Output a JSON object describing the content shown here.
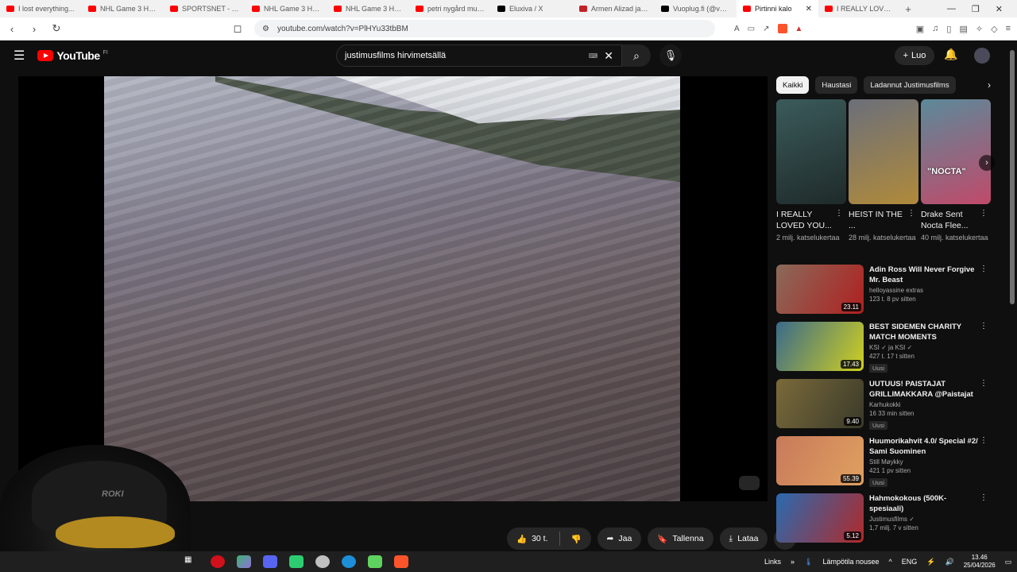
{
  "browser": {
    "tabs": [
      {
        "title": "I lost everything...",
        "color": "#ff0000"
      },
      {
        "title": "NHL Game 3 Highli",
        "color": "#ff0000"
      },
      {
        "title": "SPORTSNET - YouTu",
        "color": "#ff0000"
      },
      {
        "title": "NHL Game 3 Highli",
        "color": "#ff0000"
      },
      {
        "title": "NHL Game 3 Highli",
        "color": "#ff0000"
      },
      {
        "title": "petri nygård mun k",
        "color": "#ff0000"
      },
      {
        "title": "Eluxiva / X",
        "color": "#000000"
      },
      {
        "title": "Armen Alizad ja Se",
        "color": "#c42027"
      },
      {
        "title": "Vuoplug.fi (@vuopl",
        "color": "#000000"
      },
      {
        "title": "Pirtinni kalo",
        "color": "#ff0000",
        "active": true
      },
      {
        "title": "I REALLY LOVED YO",
        "color": "#ff0000"
      }
    ],
    "url": "youtube.com/watch?v=PlHYu33tbBM"
  },
  "header": {
    "logo_text": "YouTube",
    "region": "FI",
    "search_query": "justimusfilms hirvimetsällä",
    "create_label": "Luo"
  },
  "actions": {
    "likes": "30 t.",
    "share_label": "Jaa",
    "save_label": "Tallenna",
    "download_label": "Lataa"
  },
  "chips": [
    "Kaikki",
    "Haustasi",
    "Ladannut Justimusfilms"
  ],
  "shorts": [
    {
      "title": "I REALLY LOVED YOU...",
      "views": "2 milj. katselukertaa",
      "color1": "#3a5b5a",
      "color2": "#1f2a2a"
    },
    {
      "title": "HEIST IN THE ...",
      "views": "28 milj. katselukertaa",
      "color1": "#6b6f7a",
      "color2": "#b08a3a"
    },
    {
      "title": "Drake Sent Nocta Flee...",
      "views": "40 milj. katselukertaa",
      "color1": "#5b8a9a",
      "color2": "#c04a6a",
      "overlay": "\"NOCTA\""
    }
  ],
  "recs": [
    {
      "title": "Adin Ross Will Never Forgive Mr. Beast",
      "channel": "helloyassine extras",
      "meta": "123 t.  8 pv sitten",
      "duration": "23.11",
      "color1": "#8a6a5a",
      "color2": "#b02020",
      "badge": ""
    },
    {
      "title": "BEST SIDEMEN CHARITY MATCH MOMENTS",
      "channel": "KSI ✓ ja KSI ✓",
      "meta": "427 t.  17 t sitten",
      "duration": "17.43",
      "color1": "#3a6a8a",
      "color2": "#d0d020",
      "badge": "Uusi"
    },
    {
      "title": "UUTUUS! PAISTAJAT GRILLIMAKKARA @Paistajat",
      "channel": "Karhukokki",
      "meta": "16  33 min sitten",
      "duration": "9.40",
      "color1": "#7a6a3a",
      "color2": "#3a3a2a",
      "badge": "Uusi"
    },
    {
      "title": "Huumorikahvit 4.0/ Special #2/ Sami Suominen",
      "channel": "Still Møykky",
      "meta": "421  1 pv sitten",
      "duration": "55.39",
      "color1": "#c87a5a",
      "color2": "#e0a060",
      "badge": "Uusi"
    },
    {
      "title": "Hahmokokous (500K-spesiaali)",
      "channel": "Justimusfilms ✓",
      "meta": "1,7 milj.  7 v sitten",
      "duration": "5.12",
      "color1": "#2a6ab0",
      "color2": "#b02a2a",
      "badge": ""
    }
  ],
  "webcam": {
    "cap_text": "ROKI"
  },
  "taskbar": {
    "links_label": "Links",
    "weather": "Lämpötila nousee",
    "lang": "ENG",
    "time": "13.46",
    "date": "25/04/2026"
  }
}
